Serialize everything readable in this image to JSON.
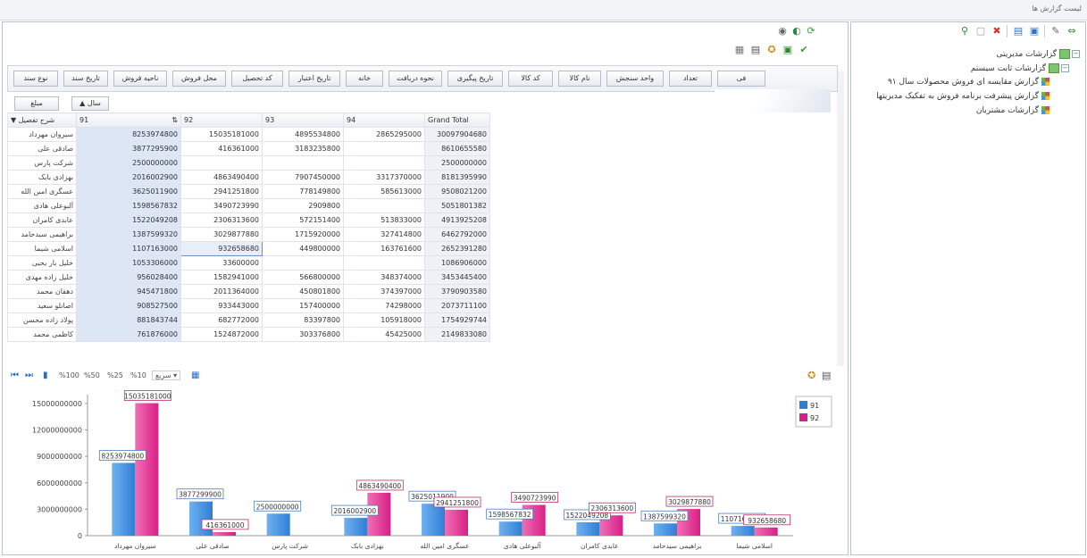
{
  "window": {
    "title": "لیست گزارش ها"
  },
  "tree": {
    "root": "گزارشات مدیریتی",
    "folder": "گزارشات ثابت سیستم",
    "items": [
      "گزارش مقایسه ای فروش محصولات سال ۹۱",
      "گزارش پیشرفت برنامه فروش به تفکیک مدیریتها",
      "گزارشات مشتریان"
    ]
  },
  "fields": [
    "نوع سند",
    "تاریخ سند",
    "ناحیه فروش",
    "محل فروش",
    "کد تحصیل",
    "تاریخ اعتبار",
    "خانه",
    "نحوه دریافت",
    "تاریخ پیگیری",
    "کد کالا",
    "نام کالا",
    "واحد سنجش",
    "تعداد",
    "فی"
  ],
  "area_labels": {
    "year": "سال",
    "amount": "مبلغ",
    "detail": "شرح تفصیل"
  },
  "pivot": {
    "columns": [
      "91",
      "92",
      "93",
      "94",
      "Grand Total"
    ],
    "rows": [
      {
        "label": "سیروان مهرداد",
        "values": [
          "8253974800",
          "15035181000",
          "4895534800",
          "2865295000",
          "30097904680"
        ]
      },
      {
        "label": "صادقی علی",
        "values": [
          "3877295900",
          "416361000",
          "3183235800",
          "",
          "8610655580"
        ]
      },
      {
        "label": "شرکت پارس",
        "values": [
          "2500000000",
          "",
          "",
          "",
          "2500000000"
        ]
      },
      {
        "label": "بهزادی بابک",
        "values": [
          "2016002900",
          "4863490400",
          "7907450000",
          "3317370000",
          "8181395990"
        ]
      },
      {
        "label": "عسگری امین الله",
        "values": [
          "3625011900",
          "2941251800",
          "778149800",
          "585613000",
          "9508021200"
        ]
      },
      {
        "label": "آلبوعلی هادی",
        "values": [
          "1598567832",
          "3490723990",
          "2909800",
          "",
          "5051801382"
        ]
      },
      {
        "label": "عابدی کامران",
        "values": [
          "1522049208",
          "2306313600",
          "572151400",
          "513833000",
          "4913925208"
        ]
      },
      {
        "label": "براهیمی سیدحامد",
        "values": [
          "1387599320",
          "3029877880",
          "1715920000",
          "327414800",
          "6462792000"
        ]
      },
      {
        "label": "اسلامی شیما",
        "values": [
          "1107163000",
          "932658680",
          "449800000",
          "163761600",
          "2652391280"
        ]
      },
      {
        "label": "خلیل بار یحیی",
        "values": [
          "1053306000",
          "33600000",
          "",
          "",
          "1086906000"
        ]
      },
      {
        "label": "خلیل زاده مهدی",
        "values": [
          "956028400",
          "1582941000",
          "566800000",
          "348374000",
          "3453445400"
        ]
      },
      {
        "label": "دهقان محمد",
        "values": [
          "945471800",
          "2011364000",
          "450801800",
          "374397000",
          "3790903580"
        ]
      },
      {
        "label": "اصانلو سعید",
        "values": [
          "908527500",
          "933443000",
          "157400000",
          "74298000",
          "2073711100"
        ]
      },
      {
        "label": "پولاد زاده محسن",
        "values": [
          "881843744",
          "682772000",
          "83397800",
          "105918000",
          "1754929744"
        ]
      },
      {
        "label": "کاظمی محمد",
        "values": [
          "761876000",
          "1524872000",
          "303376800",
          "45425000",
          "2149833080"
        ]
      }
    ]
  },
  "chart_toolbar": {
    "opts": [
      "%100",
      "%50",
      "%25",
      "%10",
      "سریع"
    ]
  },
  "chart_data": {
    "type": "bar",
    "categories": [
      "سیروان مهرداد",
      "صادقی علی",
      "شرکت پارس",
      "بهزادی بابک",
      "عسگری امین الله",
      "آلبوعلی هادی",
      "عابدی کامران",
      "براهیمی سیدحامد",
      "اسلامی شیما"
    ],
    "series": [
      {
        "name": "91",
        "values": [
          8253974800,
          3877299900,
          2500000000,
          2016002900,
          3625011900,
          1598567832,
          1522049208,
          1387599320,
          1107163000
        ],
        "labels": [
          "8253974800",
          "3877299900",
          "2500000000",
          "2016002900",
          "3625011900",
          "1598567832",
          "1522049208",
          "1387599320",
          "1107163000"
        ]
      },
      {
        "name": "92",
        "values": [
          15035181000,
          416361000,
          0,
          4863490400,
          2941251800,
          3490723990,
          2306313600,
          3029877880,
          932658680
        ],
        "labels": [
          "15035181000",
          "416361000",
          "",
          "4863490400",
          "2941251800",
          "3490723990",
          "2306313600",
          "3029877880",
          "932658680"
        ]
      }
    ],
    "ylim": [
      0,
      16000000000
    ],
    "yticks": [
      "0",
      "3000000000",
      "6000000000",
      "9000000000",
      "12000000000",
      "15000000000"
    ],
    "colors": [
      "#2f7fd6",
      "#d81f86"
    ],
    "legend": "top-right"
  }
}
